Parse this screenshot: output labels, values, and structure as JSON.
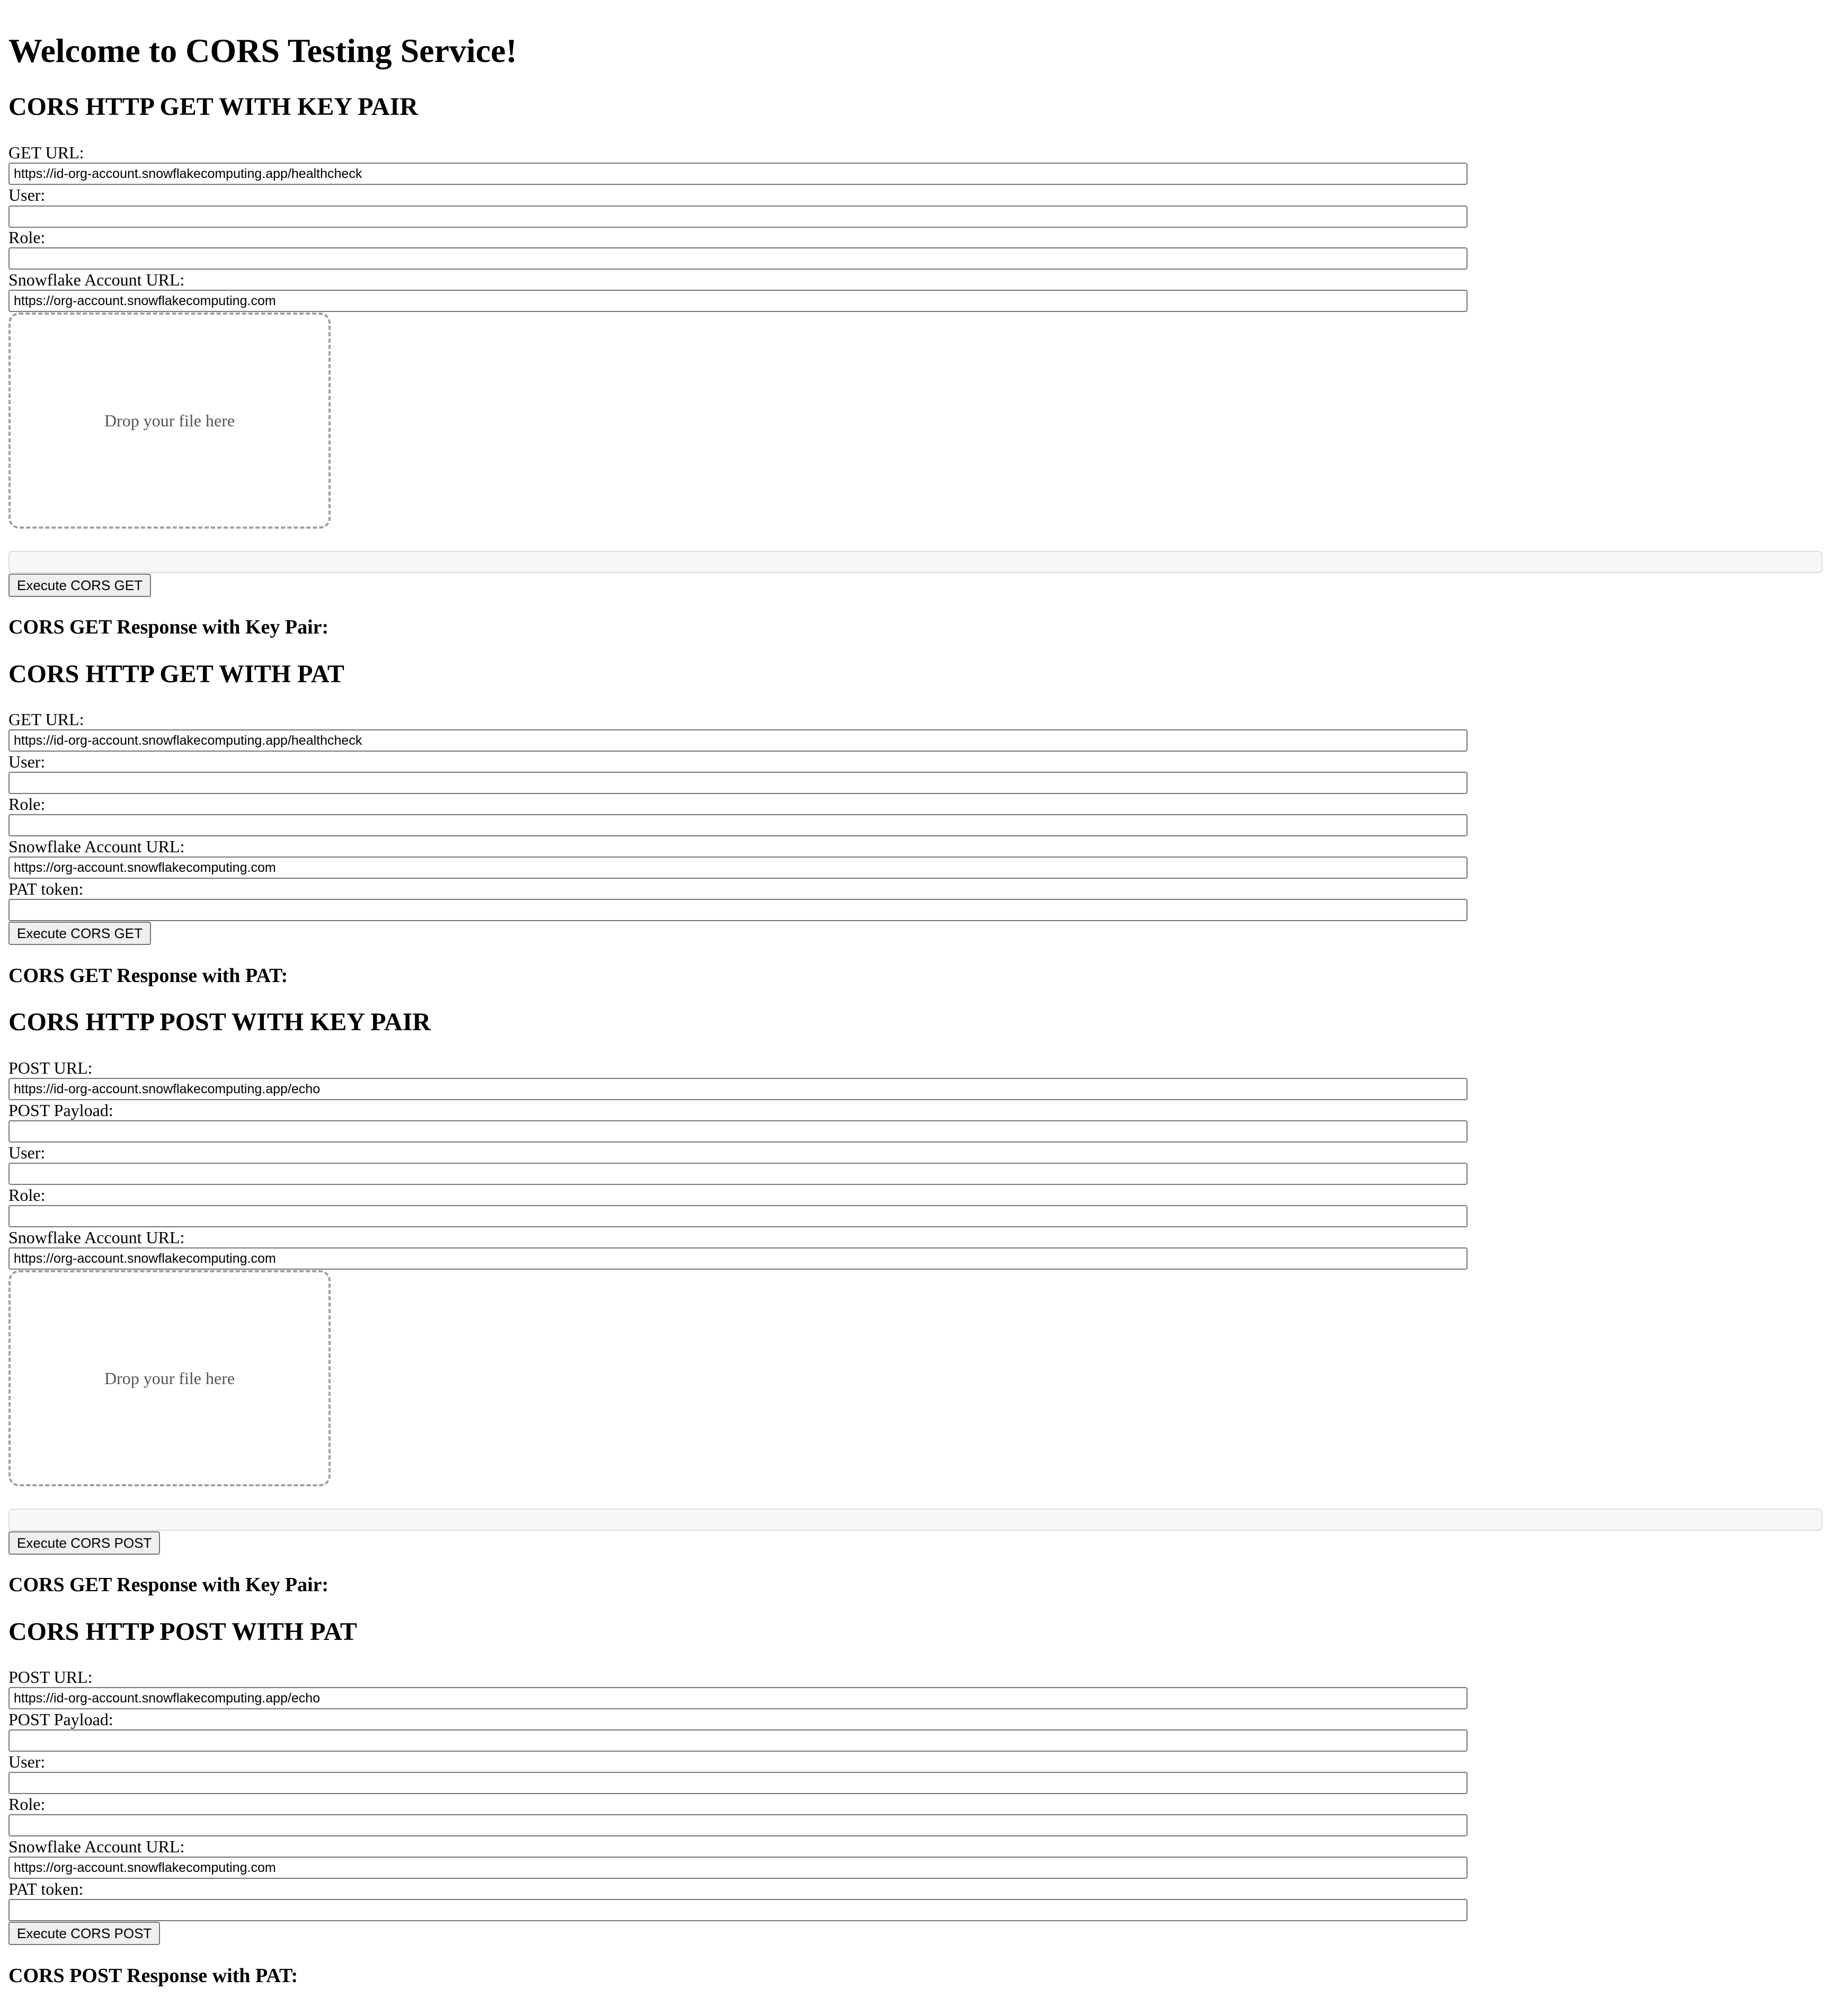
{
  "page": {
    "title": "Welcome to CORS Testing Service!"
  },
  "get_keypair": {
    "heading": "CORS HTTP GET WITH KEY PAIR",
    "url_label": "GET URL:",
    "url_value": "https://id-org-account.snowflakecomputing.app/healthcheck",
    "user_label": "User:",
    "user_value": "",
    "role_label": "Role:",
    "role_value": "",
    "account_label": "Snowflake Account URL:",
    "account_value": "https://org-account.snowflakecomputing.com",
    "drop_text": "Drop your file here",
    "button_label": "Execute CORS GET",
    "response_heading": "CORS GET Response with Key Pair:"
  },
  "get_pat": {
    "heading": "CORS HTTP GET WITH PAT",
    "url_label": "GET URL:",
    "url_value": "https://id-org-account.snowflakecomputing.app/healthcheck",
    "user_label": "User:",
    "user_value": "",
    "role_label": "Role:",
    "role_value": "",
    "account_label": "Snowflake Account URL:",
    "account_value": "https://org-account.snowflakecomputing.com",
    "pat_label": "PAT token:",
    "pat_value": "",
    "button_label": "Execute CORS GET",
    "response_heading": "CORS GET Response with PAT:"
  },
  "post_keypair": {
    "heading": "CORS HTTP POST WITH KEY PAIR",
    "url_label": "POST URL:",
    "url_value": "https://id-org-account.snowflakecomputing.app/echo",
    "payload_label": "POST Payload:",
    "payload_value": "",
    "user_label": "User:",
    "user_value": "",
    "role_label": "Role:",
    "role_value": "",
    "account_label": "Snowflake Account URL:",
    "account_value": "https://org-account.snowflakecomputing.com",
    "drop_text": "Drop your file here",
    "button_label": "Execute CORS POST",
    "response_heading": "CORS GET Response with Key Pair:"
  },
  "post_pat": {
    "heading": "CORS HTTP POST WITH PAT",
    "url_label": "POST URL:",
    "url_value": "https://id-org-account.snowflakecomputing.app/echo",
    "payload_label": "POST Payload:",
    "payload_value": "",
    "user_label": "User:",
    "user_value": "",
    "role_label": "Role:",
    "role_value": "",
    "account_label": "Snowflake Account URL:",
    "account_value": "https://org-account.snowflakecomputing.com",
    "pat_label": "PAT token:",
    "pat_value": "",
    "button_label": "Execute CORS POST",
    "response_heading": "CORS POST Response with PAT:"
  }
}
